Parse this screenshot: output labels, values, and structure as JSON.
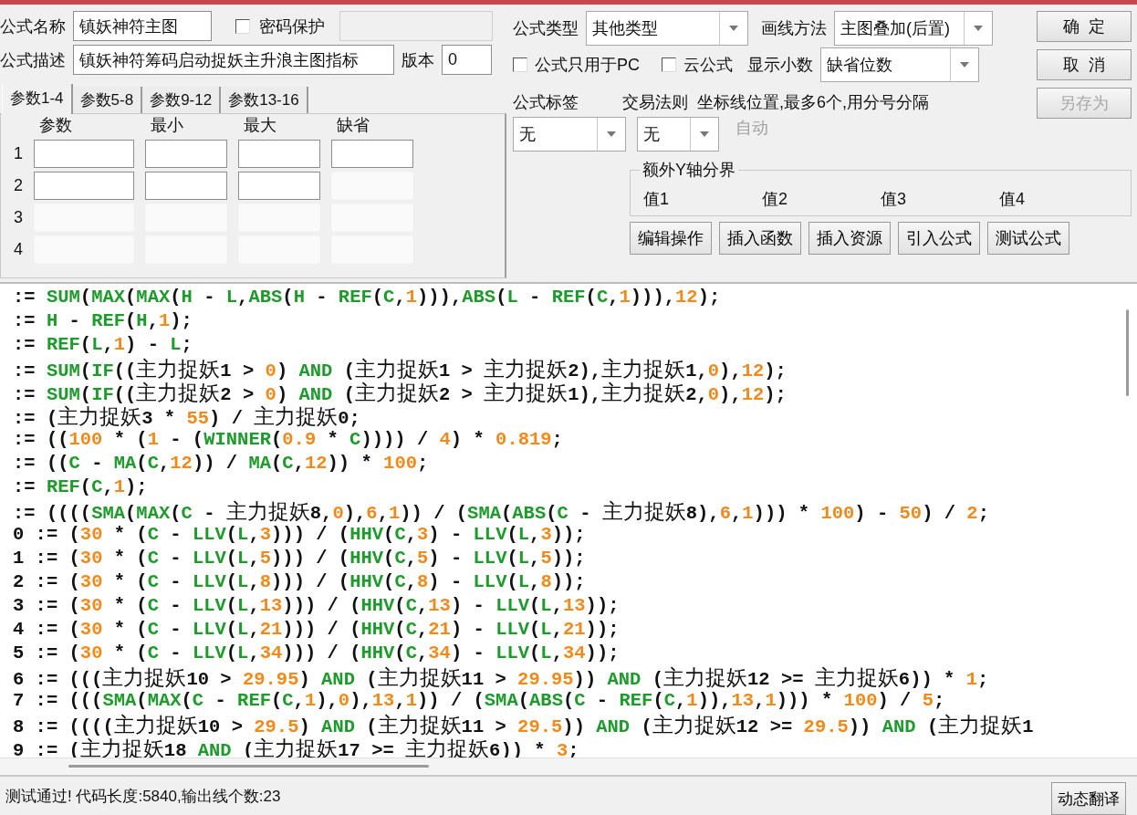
{
  "form": {
    "name": {
      "label": "公式名称",
      "value": "镇妖神符主图"
    },
    "password": {
      "label": "密码保护",
      "checked": false,
      "field_disabled": true
    },
    "description": {
      "label": "公式描述",
      "value": "镇妖神符筹码启动捉妖主升浪主图指标"
    },
    "version": {
      "label": "版本",
      "value": "0"
    }
  },
  "param_tabs": [
    {
      "label": "参数1-4",
      "selected": true
    },
    {
      "label": "参数5-8",
      "selected": false
    },
    {
      "label": "参数9-12",
      "selected": false
    },
    {
      "label": "参数13-16",
      "selected": false
    }
  ],
  "param_table": {
    "columns": [
      "参数",
      "最小",
      "最大",
      "缺省"
    ],
    "rows": [
      {
        "index": "1",
        "cells": [
          {
            "disabled": false
          },
          {
            "disabled": false
          },
          {
            "disabled": false
          },
          {
            "disabled": false
          }
        ]
      },
      {
        "index": "2",
        "cells": [
          {
            "disabled": false
          },
          {
            "disabled": false
          },
          {
            "disabled": false
          },
          {
            "disabled": true
          }
        ]
      },
      {
        "index": "3",
        "cells": [
          {
            "disabled": true
          },
          {
            "disabled": true
          },
          {
            "disabled": true
          },
          {
            "disabled": true
          }
        ]
      },
      {
        "index": "4",
        "cells": [
          {
            "disabled": true
          },
          {
            "disabled": true
          },
          {
            "disabled": true
          },
          {
            "disabled": true
          }
        ]
      }
    ]
  },
  "settings": {
    "formula_type": {
      "label": "公式类型",
      "value": "其他类型"
    },
    "draw_method": {
      "label": "画线方法",
      "value": "主图叠加(后置)"
    },
    "pc_only": {
      "label": "公式只用于PC",
      "checked": false
    },
    "cloud": {
      "label": "云公式",
      "checked": false
    },
    "decimals": {
      "label": "显示小数",
      "value": "缺省位数"
    },
    "tag": {
      "label": "公式标签",
      "value": "无"
    },
    "trade_rule": {
      "label": "交易法则",
      "value": "无"
    },
    "axis_lines": {
      "label": "坐标线位置,最多6个,用分号分隔",
      "value": "自动",
      "disabled": true
    },
    "y_axis": {
      "title": "额外Y轴分界",
      "values": [
        "值1",
        "值2",
        "值3",
        "值4"
      ]
    }
  },
  "side_buttons": [
    {
      "label": "确  定",
      "disabled": false
    },
    {
      "label": "取  消",
      "disabled": false
    },
    {
      "label": "另存为",
      "disabled": true
    }
  ],
  "tool_buttons": [
    "编辑操作",
    "插入函数",
    "插入资源",
    "引入公式",
    "测试公式"
  ],
  "code": {
    "lines": [
      ":= SUM(MAX(MAX(H - L,ABS(H - REF(C,1))),ABS(L - REF(C,1))),12);",
      ":= H - REF(H,1);",
      ":= REF(L,1) - L;",
      ":= SUM(IF((主力捉妖1 > 0) AND (主力捉妖1 > 主力捉妖2),主力捉妖1,0),12);",
      ":= SUM(IF((主力捉妖2 > 0) AND (主力捉妖2 > 主力捉妖1),主力捉妖2,0),12);",
      ":= (主力捉妖3 * 55) / 主力捉妖0;",
      ":= ((100 * (1 - (WINNER(0.9 * C)))) / 4) * 0.819;",
      ":= ((C - MA(C,12)) / MA(C,12)) * 100;",
      ":= REF(C,1);",
      ":= ((((SMA(MAX(C - 主力捉妖8,0),6,1)) / (SMA(ABS(C - 主力捉妖8),6,1))) * 100) - 50) / 2;",
      "0 := (30 * (C - LLV(L,3))) / (HHV(C,3) - LLV(L,3));",
      "1 := (30 * (C - LLV(L,5))) / (HHV(C,5) - LLV(L,5));",
      "2 := (30 * (C - LLV(L,8))) / (HHV(C,8) - LLV(L,8));",
      "3 := (30 * (C - LLV(L,13))) / (HHV(C,13) - LLV(L,13));",
      "4 := (30 * (C - LLV(L,21))) / (HHV(C,21) - LLV(L,21));",
      "5 := (30 * (C - LLV(L,34))) / (HHV(C,34) - LLV(L,34));",
      "6 := (((主力捉妖10 > 29.95) AND (主力捉妖11 > 29.95)) AND (主力捉妖12 >= 主力捉妖6)) * 1;",
      "7 := (((SMA(MAX(C - REF(C,1),0),13,1)) / (SMA(ABS(C - REF(C,1)),13,1))) * 100) / 5;",
      "8 := ((((主力捉妖10 > 29.5) AND (主力捉妖11 > 29.5)) AND (主力捉妖12 >= 29.5)) AND (主力捉妖1",
      "9 := (主力捉妖18 AND (主力捉妖17 >= 主力捉妖6)) * 3;"
    ]
  },
  "status_bar": {
    "message": "测试通过! 代码长度:5840,输出线个数:23",
    "button": "动态翻译"
  }
}
